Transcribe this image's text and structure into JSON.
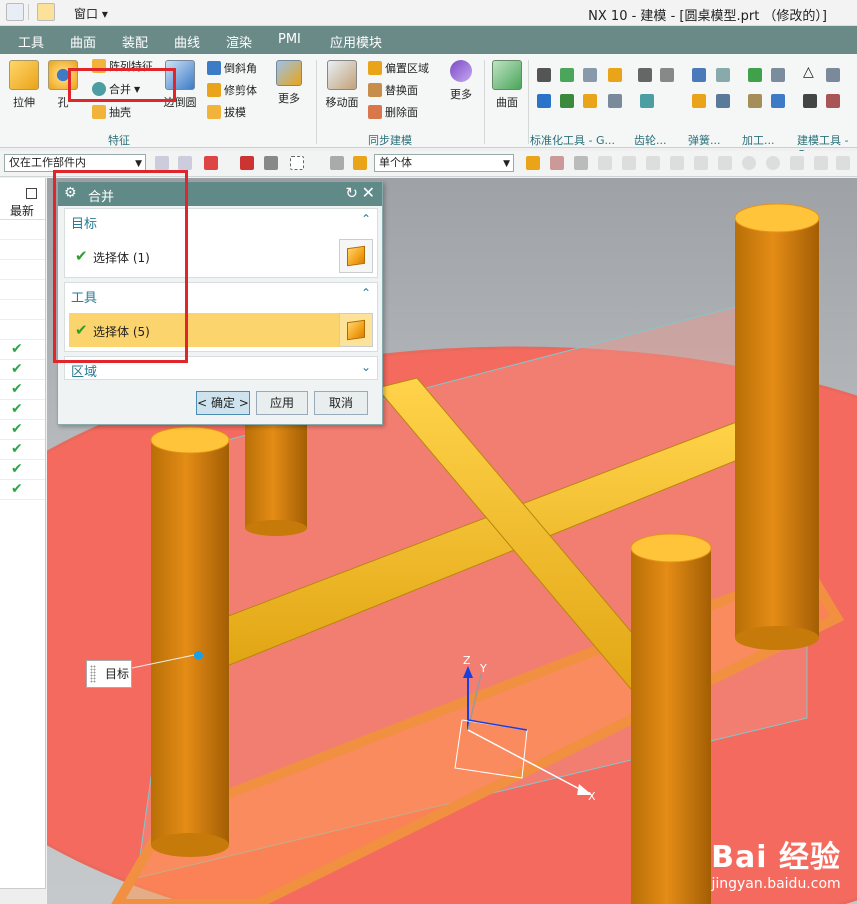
{
  "titlebar": {
    "window_menu": "窗口 ▾",
    "title": "NX 10 - 建模 - [圆桌模型.prt （修改的）]"
  },
  "menubar": {
    "tabs": [
      "工具",
      "曲面",
      "装配",
      "曲线",
      "渲染",
      "PMI",
      "应用模块"
    ]
  },
  "ribbon": {
    "extrude": "拉伸",
    "hole": "孔",
    "array_feature": "阵列特征",
    "unite": "合并",
    "shell": "抽壳",
    "edge_blend": "边倒圆",
    "chamfer": "倒斜角",
    "trim_body": "修剪体",
    "draft": "拔模",
    "more1": "更多",
    "feature_group": "特征",
    "move_face": "移动面",
    "offset_region": "偏置区域",
    "replace_face": "替换面",
    "delete_face": "删除面",
    "more2": "更多",
    "sync_group": "同步建模",
    "surface": "曲面",
    "std_tools_group": "标准化工具 - G...",
    "gear_group": "齿轮...",
    "spring_group": "弹簧...",
    "machining_group": "加工...",
    "modeling_tools_group": "建模工具 - G"
  },
  "toolbar": {
    "filter_scope": "仅在工作部件内",
    "selection_type": "单个体"
  },
  "navigator": {
    "latest_label": "最新",
    "check_count": 8
  },
  "dialog": {
    "title": "合并",
    "target": {
      "header": "目标",
      "row": "选择体 (1)"
    },
    "tool": {
      "header": "工具",
      "row": "选择体 (5)"
    },
    "region": {
      "header": "区域"
    },
    "ok": "< 确定 >",
    "apply": "应用",
    "cancel": "取消"
  },
  "viewport": {
    "target_callout": "目标",
    "axis_x": "X",
    "axis_y": "Y",
    "axis_z": "Z"
  },
  "watermark": {
    "brand": "Bai 经验",
    "url": "jingyan.baidu.com"
  },
  "colors": {
    "menubar": "#6a8a88",
    "highlight_red": "#e0262a",
    "tool_selection": "#fbd46d",
    "model_orange": "#e48c16",
    "table_top": "#f56a5e"
  }
}
